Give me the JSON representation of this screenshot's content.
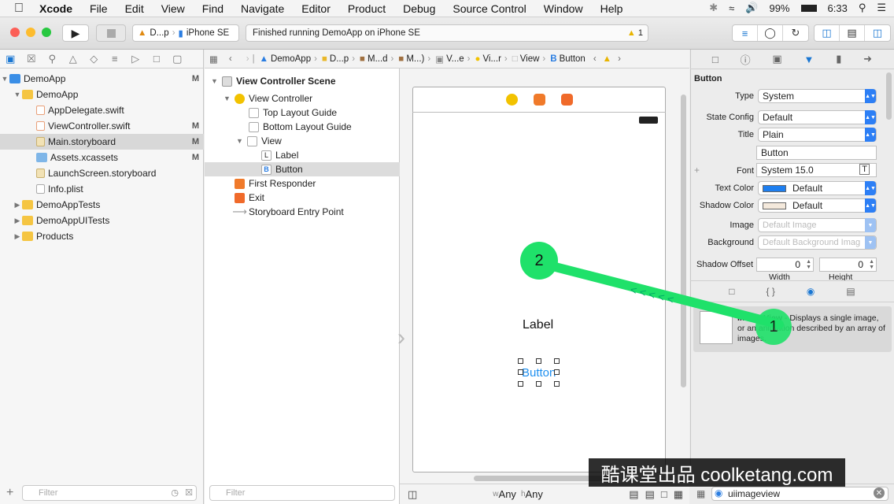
{
  "menubar": {
    "app_name": "Xcode",
    "items": [
      "File",
      "Edit",
      "View",
      "Find",
      "Navigate",
      "Editor",
      "Product",
      "Debug",
      "Source Control",
      "Window",
      "Help"
    ],
    "battery": "99%",
    "time": "6:33"
  },
  "toolbar": {
    "scheme": "D...p",
    "device": "iPhone SE",
    "status": "Finished running DemoApp on iPhone SE",
    "warning_count": "1"
  },
  "navigator": {
    "items": [
      {
        "label": "DemoApp",
        "badge": "M"
      },
      {
        "label": "DemoApp",
        "badge": ""
      },
      {
        "label": "AppDelegate.swift",
        "badge": ""
      },
      {
        "label": "ViewController.swift",
        "badge": "M"
      },
      {
        "label": "Main.storyboard",
        "badge": "M"
      },
      {
        "label": "Assets.xcassets",
        "badge": "M"
      },
      {
        "label": "LaunchScreen.storyboard",
        "badge": ""
      },
      {
        "label": "Info.plist",
        "badge": ""
      },
      {
        "label": "DemoAppTests",
        "badge": ""
      },
      {
        "label": "DemoAppUITests",
        "badge": ""
      },
      {
        "label": "Products",
        "badge": ""
      }
    ],
    "filter_placeholder": "Filter"
  },
  "jumpbar": {
    "crumbs": [
      "DemoApp",
      "D...p",
      "M...d",
      "M...)",
      "V...e",
      "Vi...r",
      "View",
      "Button"
    ]
  },
  "outline": {
    "items": [
      {
        "label": "View Controller Scene",
        "icon": ""
      },
      {
        "label": "View Controller",
        "icon": ""
      },
      {
        "label": "Top Layout Guide",
        "icon": ""
      },
      {
        "label": "Bottom Layout Guide",
        "icon": ""
      },
      {
        "label": "View",
        "icon": ""
      },
      {
        "label": "Label",
        "icon": "L"
      },
      {
        "label": "Button",
        "icon": "B"
      },
      {
        "label": "First Responder",
        "icon": ""
      },
      {
        "label": "Exit",
        "icon": ""
      },
      {
        "label": "Storyboard Entry Point",
        "icon": ""
      }
    ],
    "filter_placeholder": "Filter"
  },
  "canvas": {
    "label_text": "Label",
    "button_text": "Button",
    "size_w_prefix": "w",
    "size_w": "Any",
    "size_h_prefix": "h",
    "size_h": "Any"
  },
  "inspector": {
    "section": "Button",
    "fields": {
      "type_label": "Type",
      "type_value": "System",
      "state_label": "State Config",
      "state_value": "Default",
      "title_label": "Title",
      "title_value": "Plain",
      "title_text": "Button",
      "font_label": "Font",
      "font_value": "System 15.0",
      "textcolor_label": "Text Color",
      "textcolor_value": "Default",
      "shadowcolor_label": "Shadow Color",
      "shadowcolor_value": "Default",
      "image_label": "Image",
      "image_placeholder": "Default Image",
      "background_label": "Background",
      "background_placeholder": "Default Background Imag",
      "shadowoffset_label": "Shadow Offset",
      "shadow_w": "0",
      "shadow_h": "0",
      "width_label": "Width",
      "height_label": "Height"
    },
    "colors": {
      "text_color": "#1e7ff0",
      "shadow_color": "#f4e9dc"
    }
  },
  "library": {
    "item_name": "Image View",
    "item_desc": " - Displays a single image, or an animation described by an array of images.",
    "search_value": "uiimageview"
  },
  "overlay": {
    "step1": "1",
    "step2": "2",
    "watermark": "酷课堂出品 coolketang.com"
  }
}
